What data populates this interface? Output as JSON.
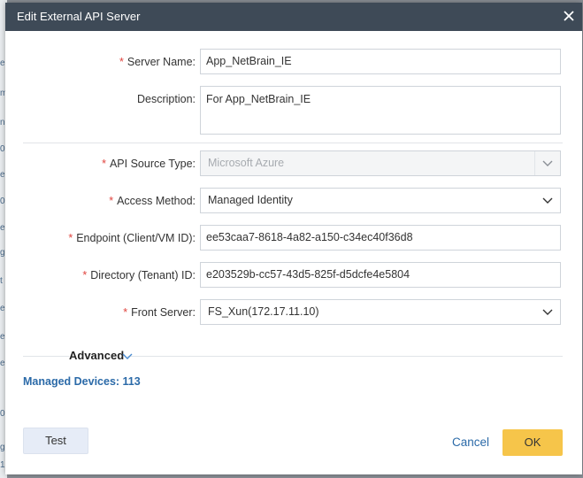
{
  "background": {
    "glyphs": [
      "e",
      "m",
      "n",
      "0.",
      "e",
      "0.",
      "e",
      "g",
      "t",
      "e",
      "e",
      "e",
      "02",
      "g",
      "1"
    ]
  },
  "dialog": {
    "title": "Edit External API Server",
    "close_icon": "close-icon"
  },
  "form": {
    "server_name": {
      "label": "Server Name:",
      "required_mark": "*",
      "value": "App_NetBrain_IE"
    },
    "description": {
      "label": "Description:",
      "value": "For App_NetBrain_IE"
    },
    "api_source_type": {
      "label": "API Source Type:",
      "required_mark": "*",
      "value": "Microsoft Azure",
      "disabled": true
    },
    "access_method": {
      "label": "Access Method:",
      "required_mark": "*",
      "value": "Managed Identity"
    },
    "endpoint": {
      "label": "Endpoint (Client/VM ID):",
      "required_mark": "*",
      "value": "ee53caa7-8618-4a82-a150-c34ec40f36d8"
    },
    "directory": {
      "label": "Directory (Tenant) ID:",
      "required_mark": "*",
      "value": "e203529b-cc57-43d5-825f-d5dcfe4e5804"
    },
    "front_server": {
      "label": "Front Server:",
      "required_mark": "*",
      "value": "FS_Xun(172.17.11.10)"
    }
  },
  "advanced": {
    "label": "Advanced",
    "icon": "chevron-down-icon"
  },
  "managed_devices": "Managed Devices: 113",
  "footer": {
    "test_label": "Test",
    "cancel_label": "Cancel",
    "ok_label": "OK"
  },
  "colors": {
    "titlebar": "#3e4a57",
    "required": "#e0443e",
    "link": "#2b6aa8",
    "ok_button": "#f6c54a",
    "test_button": "#e6ecf7"
  }
}
